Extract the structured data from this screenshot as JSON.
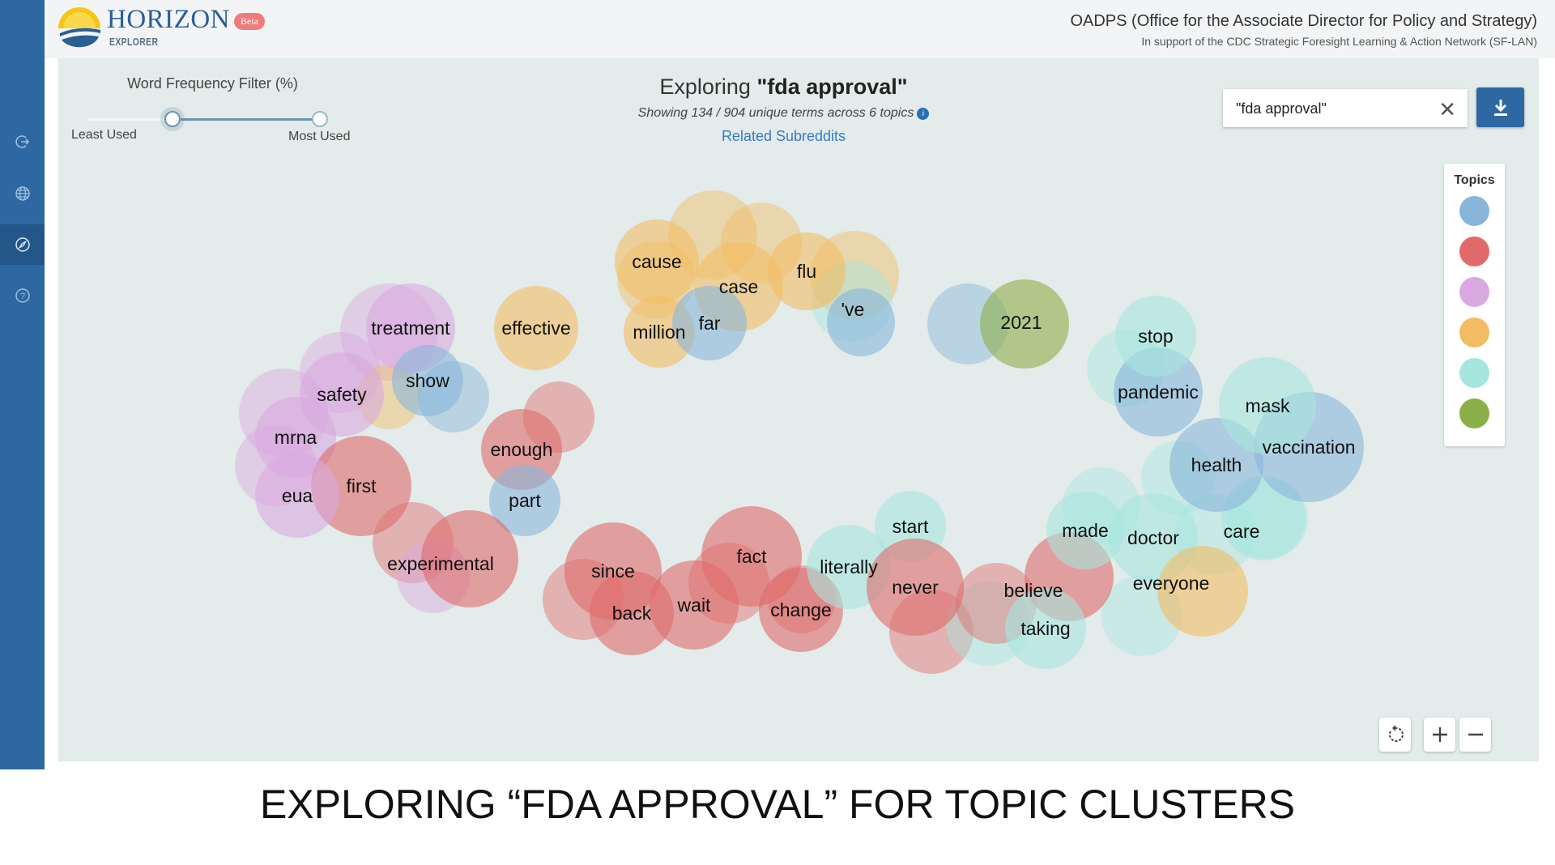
{
  "header": {
    "logo_title": "HORIZON",
    "logo_subtitle": "EXPLORER",
    "badge": "Beta",
    "org_title": "OADPS (Office for the Associate Director for Policy and Strategy)",
    "org_subtitle": "In support of the CDC Strategic Foresight Learning & Action Network (SF-LAN)"
  },
  "sidebar": {
    "items": [
      {
        "icon": "logout-icon"
      },
      {
        "icon": "globe-icon"
      },
      {
        "icon": "compass-icon",
        "active": true
      },
      {
        "icon": "help-icon"
      }
    ]
  },
  "filter": {
    "label": "Word Frequency Filter (%)",
    "min_label": "Least Used",
    "max_label": "Most Used",
    "range_low_fraction": 0.37,
    "range_high_fraction": 1.0
  },
  "explore": {
    "title_prefix": "Exploring ",
    "title_query": "\"fda approval\"",
    "subtitle": "Showing 134 / 904 unique terms across 6 topics",
    "info_icon": "i",
    "related_link": "Related Subreddits"
  },
  "search": {
    "value": "\"fda approval\"",
    "clear_icon": "close-icon",
    "download_icon": "download-icon"
  },
  "legend": {
    "title": "Topics",
    "colors": [
      "#88b6da",
      "#e06a6a",
      "#d9a8e0",
      "#f2bd62",
      "#a6e6de",
      "#8daf48"
    ]
  },
  "chart_data": {
    "type": "bubble-cluster",
    "terms": [
      {
        "term": "cause",
        "topic": 3
      },
      {
        "term": "case",
        "topic": 3
      },
      {
        "term": "flu",
        "topic": 3
      },
      {
        "term": "'ve",
        "topic": 0
      },
      {
        "term": "million",
        "topic": 3
      },
      {
        "term": "far",
        "topic": 0
      },
      {
        "term": "effective",
        "topic": 3
      },
      {
        "term": "treatment",
        "topic": 2
      },
      {
        "term": "show",
        "topic": 0
      },
      {
        "term": "safety",
        "topic": 2
      },
      {
        "term": "mrna",
        "topic": 2
      },
      {
        "term": "enough",
        "topic": 1
      },
      {
        "term": "first",
        "topic": 1
      },
      {
        "term": "eua",
        "topic": 2
      },
      {
        "term": "part",
        "topic": 0
      },
      {
        "term": "experimental",
        "topic": 1
      },
      {
        "term": "since",
        "topic": 1
      },
      {
        "term": "back",
        "topic": 1
      },
      {
        "term": "wait",
        "topic": 1
      },
      {
        "term": "fact",
        "topic": 1
      },
      {
        "term": "change",
        "topic": 1
      },
      {
        "term": "literally",
        "topic": 4
      },
      {
        "term": "start",
        "topic": 4
      },
      {
        "term": "never",
        "topic": 1
      },
      {
        "term": "believe",
        "topic": 1
      },
      {
        "term": "taking",
        "topic": 4
      },
      {
        "term": "made",
        "topic": 4
      },
      {
        "term": "doctor",
        "topic": 4
      },
      {
        "term": "care",
        "topic": 4
      },
      {
        "term": "everyone",
        "topic": 3
      },
      {
        "term": "health",
        "topic": 0
      },
      {
        "term": "vaccination",
        "topic": 0
      },
      {
        "term": "mask",
        "topic": 4
      },
      {
        "term": "pandemic",
        "topic": 0
      },
      {
        "term": "stop",
        "topic": 4
      },
      {
        "term": "2021",
        "topic": 5
      }
    ]
  },
  "controls": {
    "reset_icon": "reset-icon",
    "zoom_in_icon": "plus-icon",
    "zoom_out_icon": "minus-icon"
  },
  "caption": "EXPLORING “FDA APPROVAL” FOR TOPIC CLUSTERS"
}
